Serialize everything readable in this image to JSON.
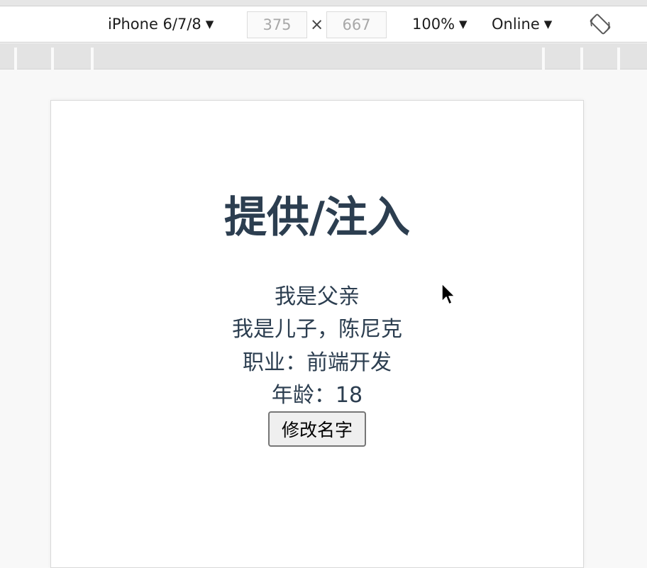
{
  "devtools": {
    "device": {
      "label": "iPhone 6/7/8",
      "caret": "▼"
    },
    "width": "375",
    "separator": "×",
    "height": "667",
    "zoom": {
      "label": "100%",
      "caret": "▼"
    },
    "network": {
      "label": "Online",
      "caret": "▼"
    },
    "rotate_icon": "rotate-screen-icon"
  },
  "page": {
    "title": "提供/注入",
    "father_line": "我是父亲",
    "son_line": "我是儿子，陈尼克",
    "job_line": "职业：前端开发",
    "age_line": "年龄：18",
    "rename_button": "修改名字"
  },
  "colors": {
    "text": "#2c3e50",
    "button_bg": "#efefef",
    "button_border": "#767676"
  }
}
